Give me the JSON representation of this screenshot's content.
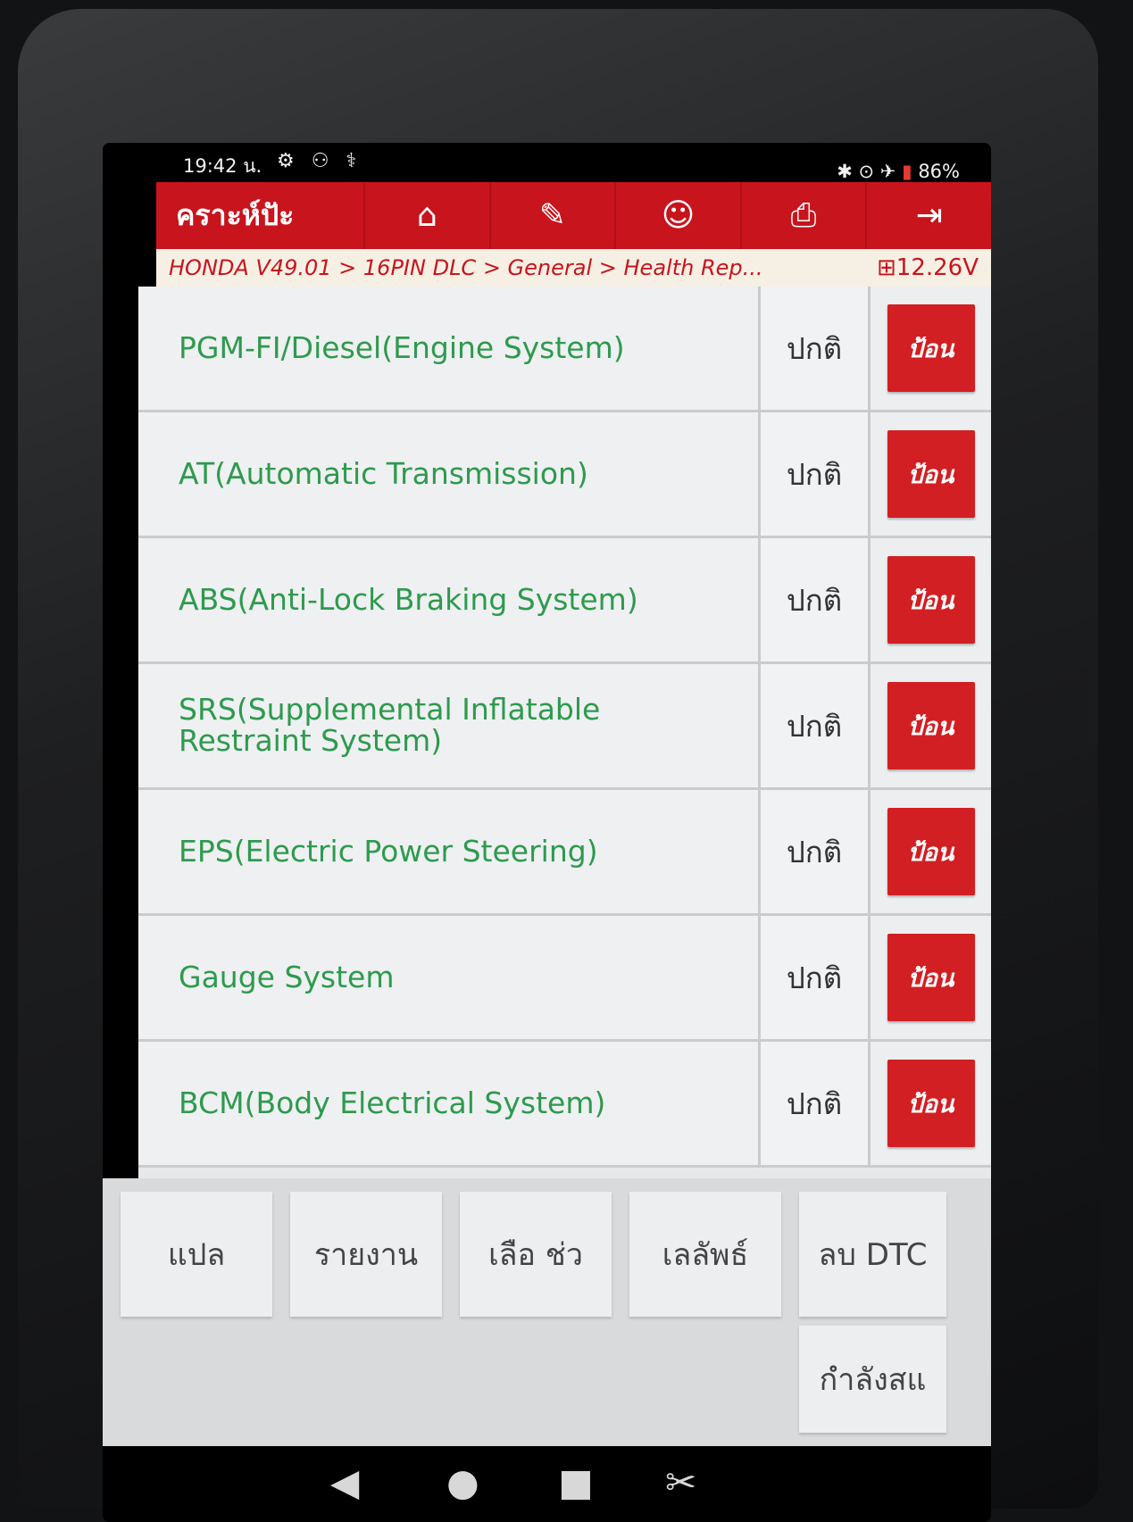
{
  "status_bar": {
    "time": "19:42 น.",
    "left_icons": "⚙ ⚇ ⚕",
    "right_icons": "✱ ⊙  ✈",
    "battery": "86%"
  },
  "toolbar": {
    "title": "คราะห์ปัะ",
    "buttons": [
      {
        "name": "home-icon",
        "glyph": "⌂"
      },
      {
        "name": "edit-icon",
        "glyph": "✎"
      },
      {
        "name": "user-icon",
        "glyph": "☺"
      },
      {
        "name": "print-icon",
        "glyph": "⎙"
      },
      {
        "name": "exit-icon",
        "glyph": "⇥"
      }
    ]
  },
  "breadcrumb": {
    "path": "HONDA V49.01 > 16PIN DLC > General > Health Rep...",
    "voltage": "12.26V"
  },
  "rows": [
    {
      "system": "PGM-FI/Diesel(Engine System)",
      "status": "ปกติ",
      "action": "ป้อน"
    },
    {
      "system": "AT(Automatic Transmission)",
      "status": "ปกติ",
      "action": "ป้อน"
    },
    {
      "system": "ABS(Anti-Lock Braking System)",
      "status": "ปกติ",
      "action": "ป้อน"
    },
    {
      "system": "SRS(Supplemental Inflatable Restraint System)",
      "status": "ปกติ",
      "action": "ป้อน"
    },
    {
      "system": "EPS(Electric Power Steering)",
      "status": "ปกติ",
      "action": "ป้อน"
    },
    {
      "system": "Gauge System",
      "status": "ปกติ",
      "action": "ป้อน"
    },
    {
      "system": "BCM(Body Electrical System)",
      "status": "ปกติ",
      "action": "ป้อน"
    }
  ],
  "footer_buttons": {
    "translate": "แปล",
    "report": "รายงาน",
    "select": "เลือ    ช่ว",
    "results": "เลลัพธ์",
    "clear_dtc": "ลบ DTC",
    "in_progress": "กำลังสแ"
  },
  "colors": {
    "toolbar_red": "#c8141c",
    "system_green": "#2e9a4d",
    "button_red": "#d21f24"
  }
}
